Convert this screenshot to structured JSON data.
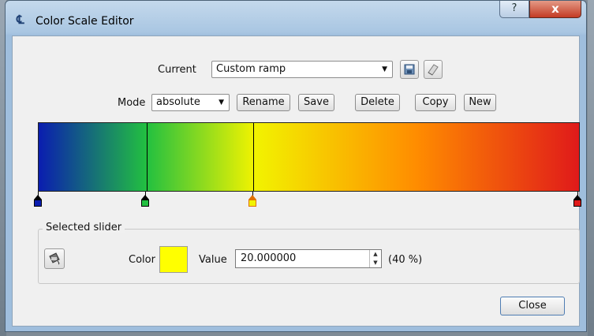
{
  "window": {
    "title": "Color Scale Editor",
    "help_label": "?",
    "close_label": "x"
  },
  "toolbar": {
    "current_label": "Current",
    "current_value": "Custom ramp",
    "mode_label": "Mode",
    "mode_value": "absolute",
    "buttons": {
      "rename": "Rename",
      "save": "Save",
      "delete": "Delete",
      "copy": "Copy",
      "new": "New"
    }
  },
  "ramp": {
    "stops": [
      {
        "name": "blue",
        "color": "#0a1db0"
      },
      {
        "name": "green",
        "color": "#22c040"
      },
      {
        "name": "yellow",
        "color": "#f2f300"
      },
      {
        "name": "red",
        "color": "#e01a1a"
      }
    ],
    "selected": "yellow"
  },
  "selected_slider": {
    "title": "Selected slider",
    "color_label": "Color",
    "color": "#ffff00",
    "value_label": "Value",
    "value": "20.000000",
    "percent": "(40 %)"
  },
  "footer": {
    "close_label": "Close"
  }
}
